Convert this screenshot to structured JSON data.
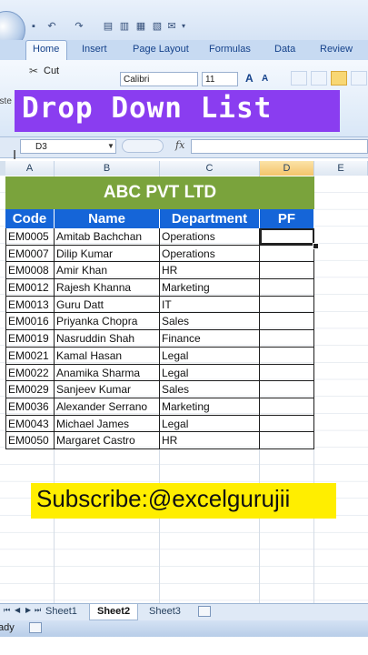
{
  "toolbar": {
    "qat_dropdown": "▾"
  },
  "ribbon": {
    "tabs": [
      {
        "label": "Home"
      },
      {
        "label": "Insert"
      },
      {
        "label": "Page Layout"
      },
      {
        "label": "Formulas"
      },
      {
        "label": "Data"
      },
      {
        "label": "Review"
      }
    ],
    "cut_label": "Cut",
    "paste_label": "aste",
    "font_name": "Calibri",
    "font_size": "11"
  },
  "banner": {
    "text": "Drop Down List",
    "color": "#8a3df0"
  },
  "formula_bar": {
    "name_box": "D3",
    "fx": "fx",
    "value": ""
  },
  "columns": [
    "A",
    "B",
    "C",
    "D",
    "E"
  ],
  "table": {
    "title": "ABC PVT LTD",
    "title_color": "#7aa33c",
    "header_color": "#1565d8",
    "headers": [
      "Code",
      "Name",
      "Department",
      "PF"
    ],
    "rows": [
      [
        "EM0005",
        "Amitab Bachchan",
        "Operations",
        ""
      ],
      [
        "EM0007",
        "Dilip Kumar",
        "Operations",
        ""
      ],
      [
        "EM0008",
        "Amir Khan",
        "HR",
        ""
      ],
      [
        "EM0012",
        "Rajesh Khanna",
        "Marketing",
        ""
      ],
      [
        "EM0013",
        "Guru Datt",
        "IT",
        ""
      ],
      [
        "EM0016",
        "Priyanka Chopra",
        "Sales",
        ""
      ],
      [
        "EM0019",
        "Nasruddin Shah",
        "Finance",
        ""
      ],
      [
        "EM0021",
        "Kamal Hasan",
        "Legal",
        ""
      ],
      [
        "EM0022",
        "Anamika Sharma",
        "Legal",
        ""
      ],
      [
        "EM0029",
        "Sanjeev Kumar",
        "Sales",
        ""
      ],
      [
        "EM0036",
        "Alexander Serrano",
        "Marketing",
        ""
      ],
      [
        "EM0043",
        "Michael James",
        "Legal",
        ""
      ],
      [
        "EM0050",
        "Margaret Castro",
        "HR",
        ""
      ]
    ]
  },
  "subscribe": {
    "text": "Subscribe:@excelgurujii",
    "color": "#ffee00"
  },
  "sheets": {
    "tabs": [
      {
        "label": "Sheet1"
      },
      {
        "label": "Sheet2"
      },
      {
        "label": "Sheet3"
      }
    ],
    "active": "Sheet2"
  },
  "status": {
    "text": "ady"
  }
}
